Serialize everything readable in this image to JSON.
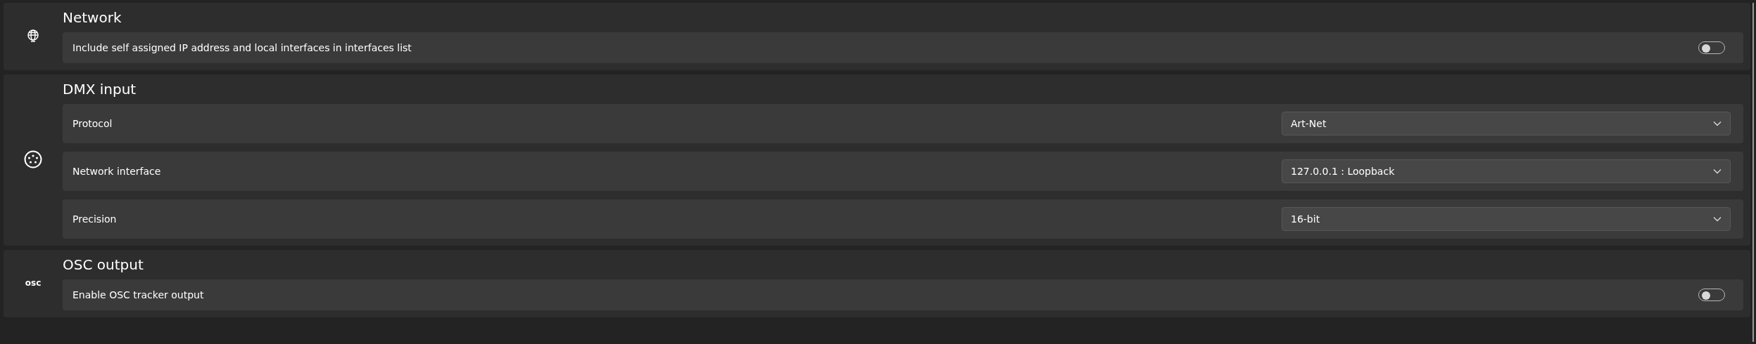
{
  "sections": [
    {
      "title": "Network",
      "rows": [
        {
          "kind": "toggle",
          "label": "Include self assigned IP address and local interfaces in interfaces list",
          "on": false
        }
      ]
    },
    {
      "title": "DMX input",
      "rows": [
        {
          "kind": "dropdown",
          "label": "Protocol",
          "value": "Art-Net"
        },
        {
          "kind": "dropdown",
          "label": "Network interface",
          "value": "127.0.0.1 : Loopback"
        },
        {
          "kind": "dropdown",
          "label": "Precision",
          "value": "16-bit"
        }
      ]
    },
    {
      "title": "OSC output",
      "icon_label": "osc",
      "rows": [
        {
          "kind": "toggle",
          "label": "Enable OSC tracker output",
          "on": false
        }
      ]
    }
  ]
}
